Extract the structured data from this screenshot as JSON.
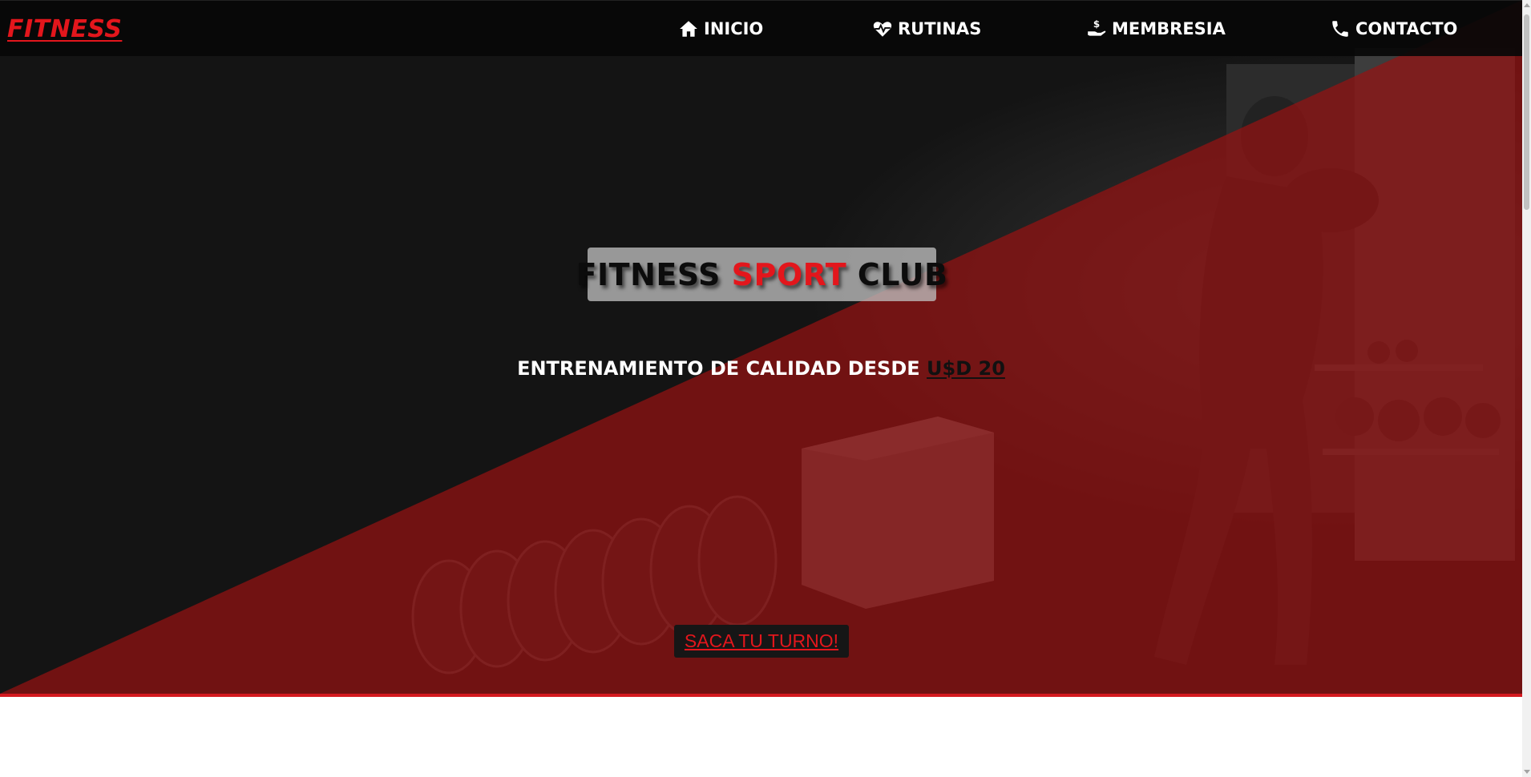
{
  "navbar": {
    "brand": "FITNESS",
    "items": [
      {
        "label": "INICIO",
        "icon": "home-icon"
      },
      {
        "label": "RUTINAS",
        "icon": "heartbeat-icon"
      },
      {
        "label": "MEMBRESIA",
        "icon": "hand-dollar-icon"
      },
      {
        "label": "CONTACTO",
        "icon": "phone-icon"
      }
    ]
  },
  "hero": {
    "title_part1": "FITNESS",
    "title_part2": "SPORT",
    "title_part3": "CLUB",
    "tagline_prefix": "ENTRENAMIENTO DE CALIDAD DESDE",
    "tagline_price": "U$D 20",
    "cta_label": "SACA TU TURNO!"
  },
  "colors": {
    "accent": "#e3161c",
    "hero_dark": "#141414",
    "hero_red": "#7a1212",
    "navbar_bg": "#080808"
  }
}
